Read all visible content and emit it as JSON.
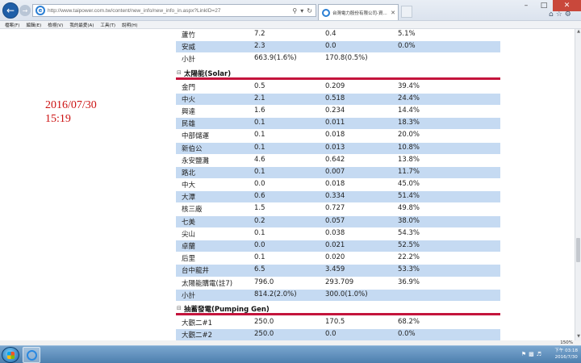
{
  "browser": {
    "url": "http://www.taipower.com.tw/content/new_info/new_info_in.aspx?LinkID=27",
    "tab_title": "台灣電力股份有限公司-資...",
    "menu": [
      "檔案(F)",
      "編輯(E)",
      "檢視(V)",
      "我的最愛(A)",
      "工具(T)",
      "說明(H)"
    ],
    "zoom": "150%"
  },
  "stamp": {
    "date": "2016/07/30",
    "time": "15:19"
  },
  "top_rows": [
    {
      "name": "蘆竹",
      "capacity": "7.2",
      "output": "0.4",
      "ratio": "5.1%"
    },
    {
      "name": "安威",
      "capacity": "2.3",
      "output": "0.0",
      "ratio": "0.0%"
    },
    {
      "name": "小計",
      "capacity": "663.9(1.6%)",
      "output": "170.8(0.5%)",
      "ratio": ""
    }
  ],
  "solar": {
    "title": "太陽能(Solar)",
    "rows": [
      {
        "name": "金門",
        "capacity": "0.5",
        "output": "0.209",
        "ratio": "39.4%"
      },
      {
        "name": "中火",
        "capacity": "2.1",
        "output": "0.518",
        "ratio": "24.4%"
      },
      {
        "name": "興達",
        "capacity": "1.6",
        "output": "0.234",
        "ratio": "14.4%"
      },
      {
        "name": "民雄",
        "capacity": "0.1",
        "output": "0.011",
        "ratio": "18.3%"
      },
      {
        "name": "中部儲運",
        "capacity": "0.1",
        "output": "0.018",
        "ratio": "20.0%"
      },
      {
        "name": "新伯公",
        "capacity": "0.1",
        "output": "0.013",
        "ratio": "10.8%"
      },
      {
        "name": "永安鹽灘",
        "capacity": "4.6",
        "output": "0.642",
        "ratio": "13.8%"
      },
      {
        "name": "路北",
        "capacity": "0.1",
        "output": "0.007",
        "ratio": "11.7%"
      },
      {
        "name": "中大",
        "capacity": "0.0",
        "output": "0.018",
        "ratio": "45.0%"
      },
      {
        "name": "大潭",
        "capacity": "0.6",
        "output": "0.334",
        "ratio": "51.4%"
      },
      {
        "name": "核三廠",
        "capacity": "1.5",
        "output": "0.727",
        "ratio": "49.8%"
      },
      {
        "name": "七美",
        "capacity": "0.2",
        "output": "0.057",
        "ratio": "38.0%"
      },
      {
        "name": "尖山",
        "capacity": "0.1",
        "output": "0.038",
        "ratio": "54.3%"
      },
      {
        "name": "卓蘭",
        "capacity": "0.0",
        "output": "0.021",
        "ratio": "52.5%"
      },
      {
        "name": "后里",
        "capacity": "0.1",
        "output": "0.020",
        "ratio": "22.2%"
      },
      {
        "name": "台中龍井",
        "capacity": "6.5",
        "output": "3.459",
        "ratio": "53.3%"
      },
      {
        "name": "太陽能購電(註7)",
        "capacity": "796.0",
        "output": "293.709",
        "ratio": "36.9%"
      },
      {
        "name": "小計",
        "capacity": "814.2(2.0%)",
        "output": "300.0(1.0%)",
        "ratio": ""
      }
    ]
  },
  "pumping": {
    "title": "抽蓄發電(Pumping Gen)",
    "rows": [
      {
        "name": "大觀二#1",
        "capacity": "250.0",
        "output": "170.5",
        "ratio": "68.2%"
      },
      {
        "name": "大觀二#2",
        "capacity": "250.0",
        "output": "0.0",
        "ratio": "0.0%"
      }
    ]
  },
  "taskbar": {
    "time": "下午 03:18",
    "date": "2016/7/30"
  }
}
